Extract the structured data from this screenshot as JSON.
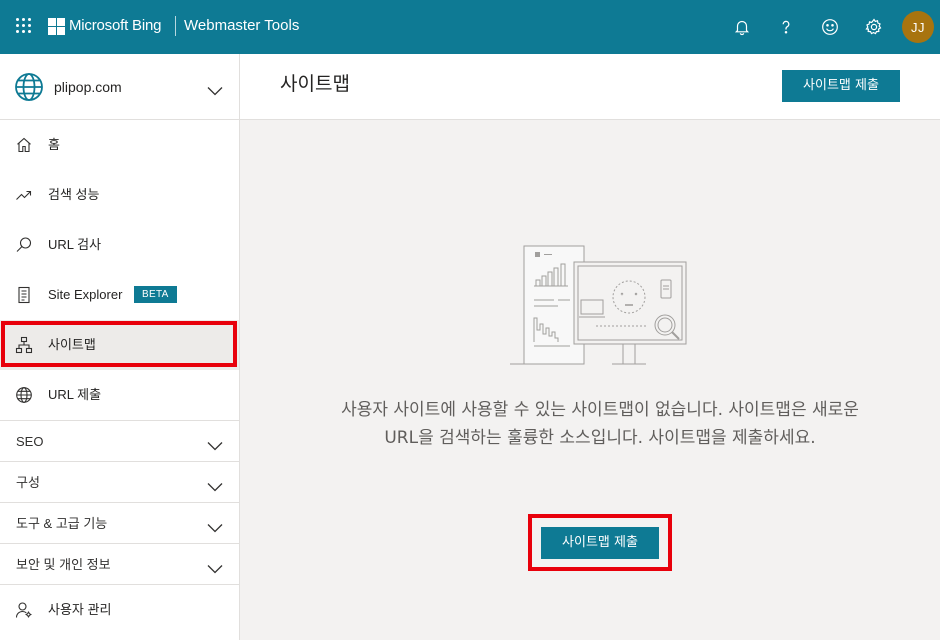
{
  "topbar": {
    "brand": "Microsoft Bing",
    "product": "Webmaster Tools",
    "avatar_initials": "JJ",
    "icons": [
      "apps-icon",
      "bell-icon",
      "help-icon",
      "feedback-smiley-icon",
      "gear-icon"
    ],
    "colors": {
      "bar": "#0e7a94",
      "avatar": "#a8740f"
    }
  },
  "sidebar": {
    "site": "plipop.com",
    "items": [
      {
        "label": "홈",
        "icon": "home-icon"
      },
      {
        "label": "검색 성능",
        "icon": "trend-icon"
      },
      {
        "label": "URL 검사",
        "icon": "search-icon"
      },
      {
        "label": "Site Explorer",
        "icon": "explorer-icon",
        "badge": "BETA"
      },
      {
        "label": "사이트맵",
        "icon": "sitemap-icon",
        "active": true
      },
      {
        "label": "URL 제출",
        "icon": "globe-icon"
      }
    ],
    "sections": [
      {
        "label": "SEO"
      },
      {
        "label": "구성"
      },
      {
        "label": "도구 & 고급 기능"
      },
      {
        "label": "보안 및 개인 정보"
      }
    ],
    "footer_item": {
      "label": "사용자 관리",
      "icon": "user-icon"
    }
  },
  "main": {
    "title": "사이트맵",
    "submit_button": "사이트맵 제출",
    "empty_message": "사용자 사이트에 사용할 수 있는 사이트맵이 없습니다. 사이트맵은 새로운 URL을 검색하는 훌륭한 소스입니다. 사이트맵을 제출하세요.",
    "empty_button": "사이트맵 제출"
  }
}
